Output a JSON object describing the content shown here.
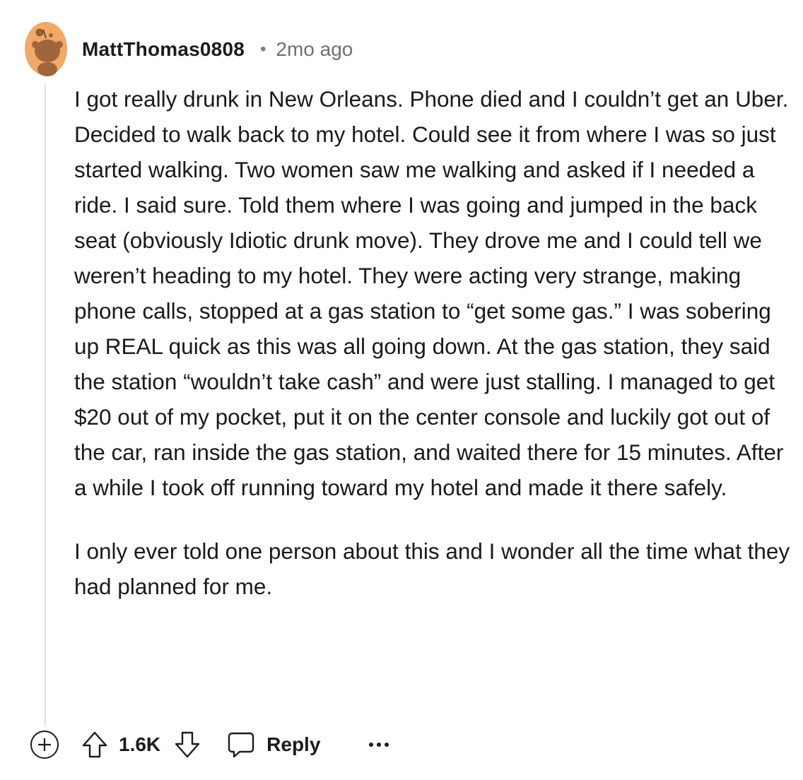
{
  "comment": {
    "author": "MattThomas0808",
    "separator": "•",
    "timestamp": "2mo ago",
    "avatar_icon": "snoo-avatar-icon",
    "paragraphs": [
      "I got really drunk in New Orleans. Phone died and I couldn’t get an Uber. Decided to walk back to my hotel. Could see it from where I was so just started walking. Two women saw me walking and asked if I needed a ride. I said sure. Told them where I was going and jumped in the back seat (obviously Idiotic drunk move). They drove me and I could tell we weren’t heading to my hotel. They were acting very strange, making phone calls, stopped at a gas station to “get some gas.” I was sobering up REAL quick as this was all going down. At the gas station, they said the station “wouldn’t take cash” and were just stalling. I managed to get $20 out of my pocket, put it on the center console and luckily got out of the car, ran inside the gas station, and waited there for 15 minutes. After a while I took off running toward my hotel and made it there safely.",
      "I only ever told one person about this and I wonder all the time what they had planned for me."
    ]
  },
  "actions": {
    "expand_icon": "plus-circle-icon",
    "upvote_icon": "arrow-up-icon",
    "score": "1.6K",
    "downvote_icon": "arrow-down-icon",
    "reply_icon": "speech-bubble-icon",
    "reply_label": "Reply",
    "more_icon": "ellipsis-icon"
  },
  "colors": {
    "avatar_bg": "#f0a968",
    "avatar_figure": "#a0653a",
    "thread_line": "#dfe3e6",
    "text": "#1c1c1c",
    "muted": "#6f6f6f"
  }
}
